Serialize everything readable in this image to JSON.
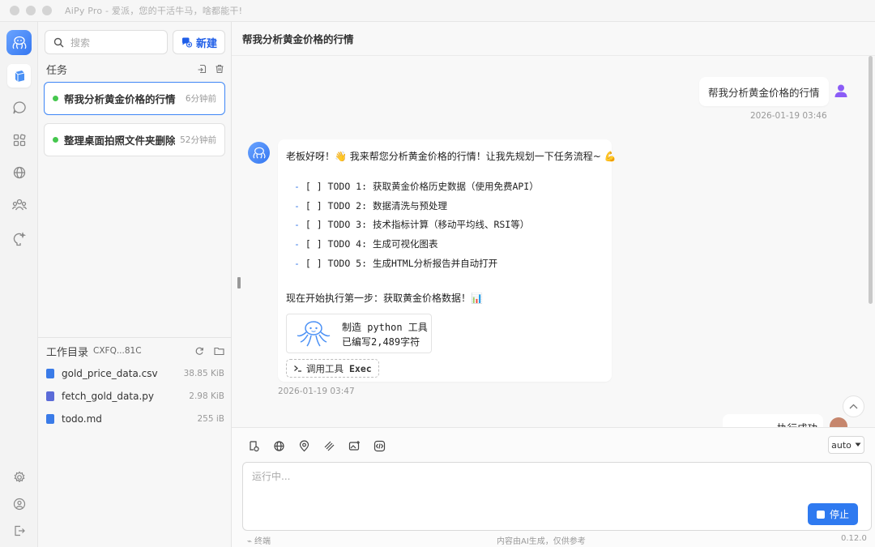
{
  "window": {
    "title": "AiPy Pro - 爱派，您的干活牛马，啥都能干!"
  },
  "sidebar": {
    "search_placeholder": "搜索",
    "new_label": "新建",
    "tasks_header": "任务",
    "tasks": [
      {
        "label": "帮我分析黄金价格的行情",
        "time": "6分钟前",
        "status": "running"
      },
      {
        "label": "整理桌面拍照文件夹删除重",
        "time": "52分钟前",
        "status": "running"
      }
    ],
    "workdir": {
      "title": "工作目录",
      "path": "CXFQ...81C",
      "files": [
        {
          "name": "gold_price_data.csv",
          "size": "38.85 KiB",
          "icon_color": "#3a7be8"
        },
        {
          "name": "fetch_gold_data.py",
          "size": "2.98 KiB",
          "icon_color": "#5b6bd8"
        },
        {
          "name": "todo.md",
          "size": "255 iB",
          "icon_color": "#3a7be8"
        }
      ]
    }
  },
  "main": {
    "title": "帮我分析黄金价格的行情",
    "user_message": {
      "text": "帮我分析黄金价格的行情",
      "timestamp": "2026-01-19 03:46"
    },
    "bot_message": {
      "greeting": "老板好呀！👋 我来帮您分析黄金价格的行情！让我先规划一下任务流程~ 💪",
      "todos": [
        "[ ] TODO 1: 获取黄金价格历史数据（使用免费API）",
        "[ ] TODO 2: 数据清洗与预处理",
        "[ ] TODO 3: 技术指标计算（移动平均线、RSI等）",
        "[ ] TODO 4: 生成可视化图表",
        "[ ] TODO 5: 生成HTML分析报告并自动打开"
      ],
      "next_step": "现在开始执行第一步：获取黄金价格数据！📊",
      "tool_card": {
        "line1": "制造 python 工具",
        "line2": "已编写2,489字符"
      },
      "exec_label": "调用工具",
      "exec_name": "Exec",
      "timestamp": "2026-01-19 03:47"
    },
    "partial_message": "执行成功"
  },
  "composer": {
    "model_select": "auto",
    "placeholder": "运行中...",
    "stop_label": "停止",
    "terminal_label": "终端",
    "disclaimer": "内容由AI生成，仅供参考",
    "version": "0.12.0"
  },
  "colors": {
    "accent": "#2f7af0",
    "running": "#45c74e",
    "border_active": "#3e86f6"
  }
}
